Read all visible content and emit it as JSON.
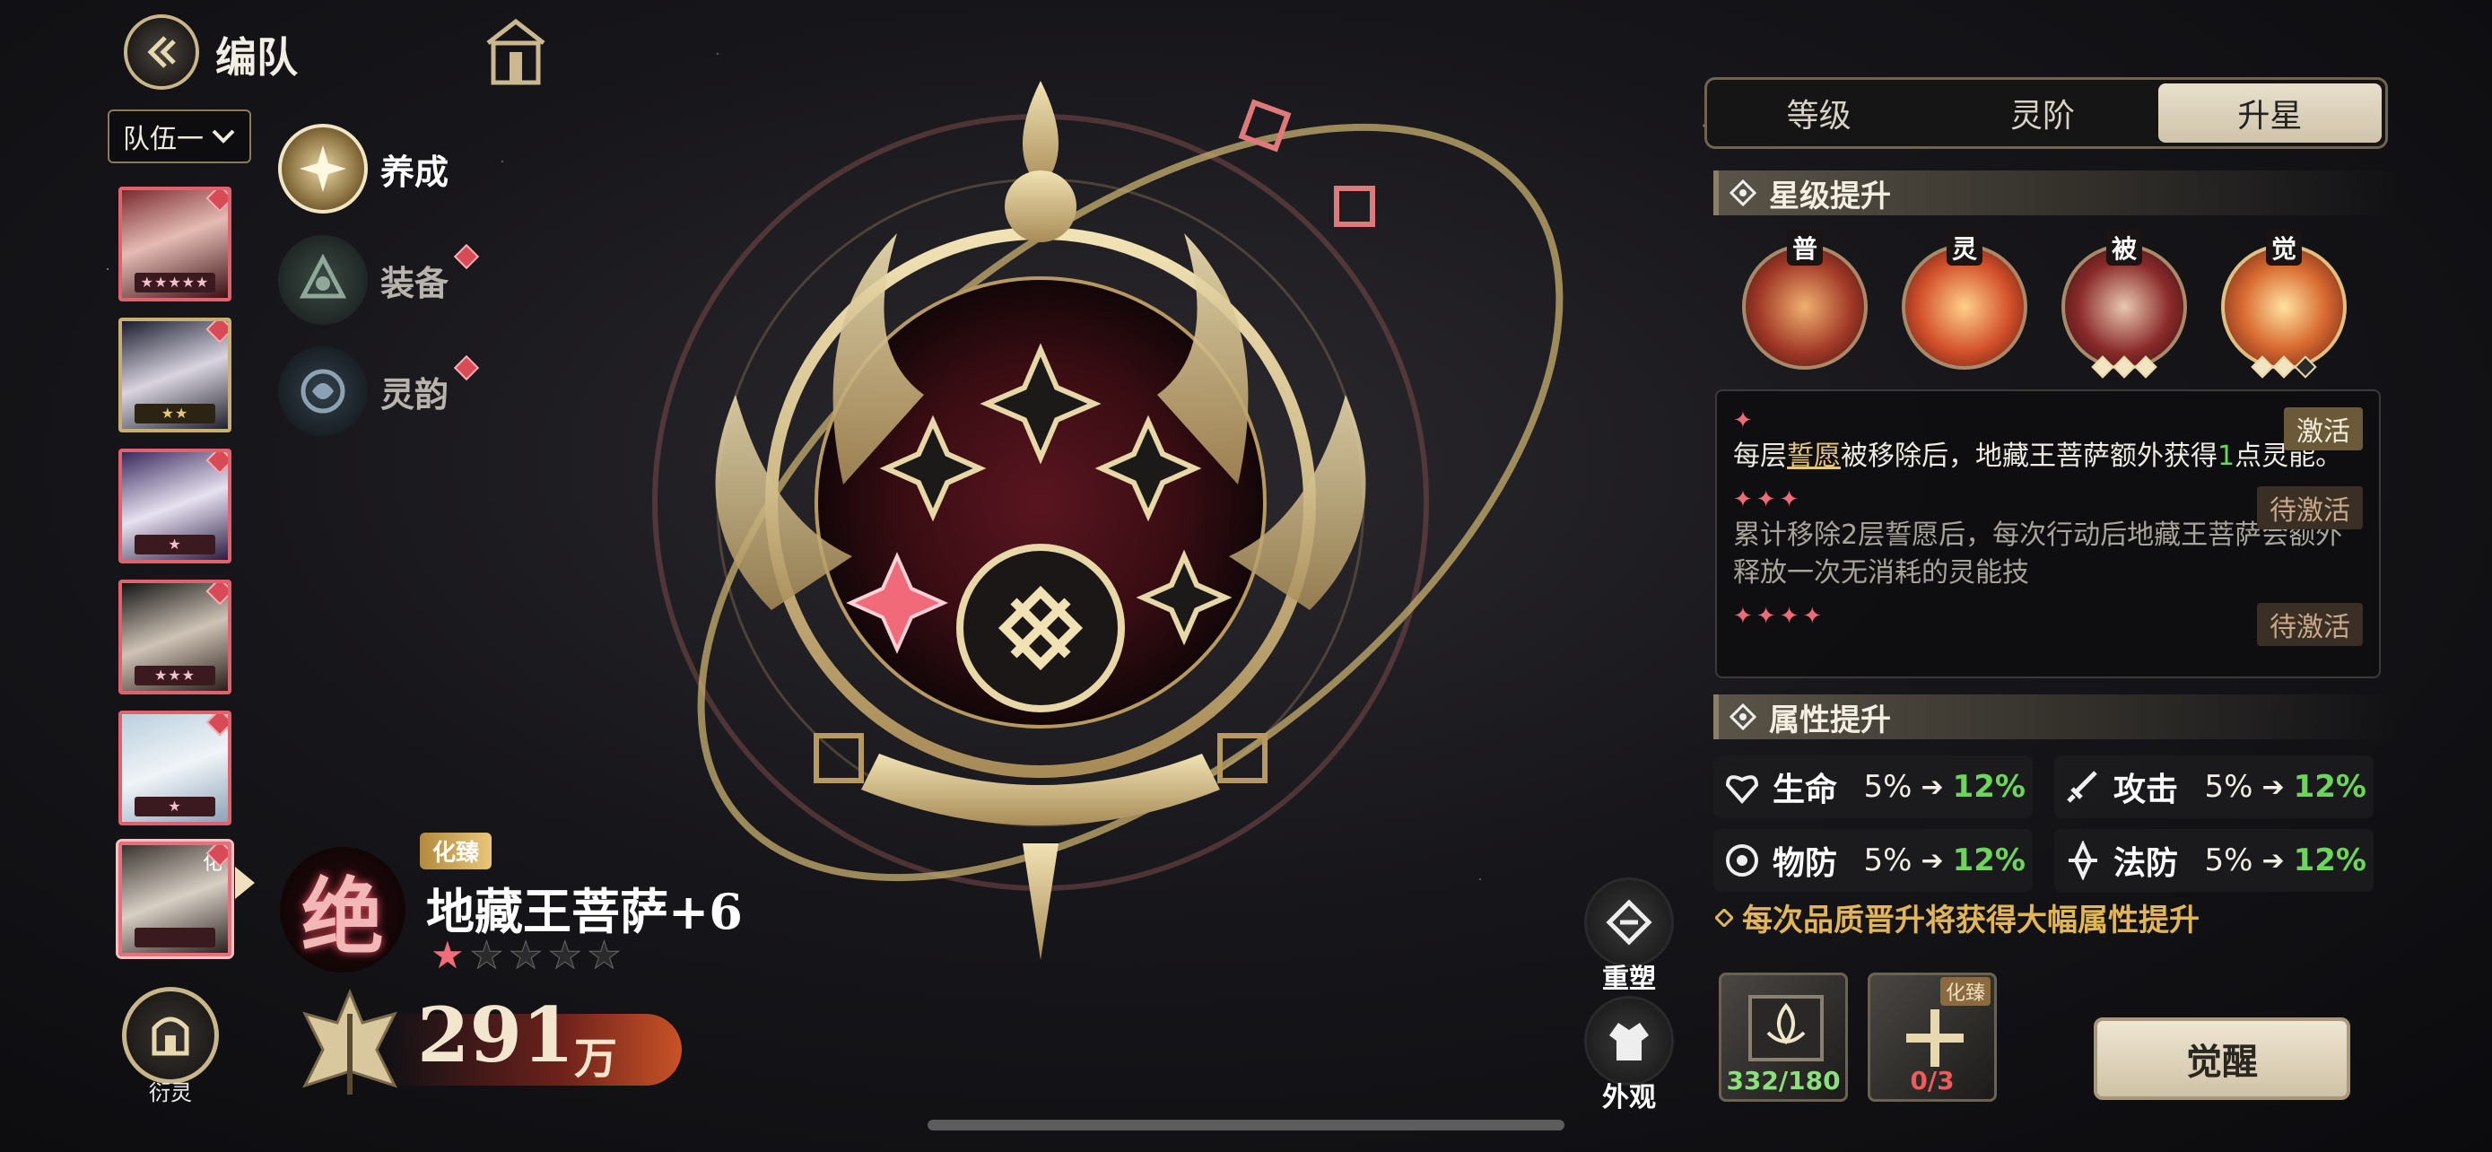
{
  "header": {
    "title": "编队"
  },
  "team_select": {
    "label": "队伍一"
  },
  "roster": [
    {
      "stars": "★★★★★"
    },
    {
      "stars": "★★"
    },
    {
      "stars": "★"
    },
    {
      "stars": "★★★"
    },
    {
      "stars": "★"
    },
    {
      "stars": "",
      "tag": "化"
    }
  ],
  "side_menu": [
    {
      "label": "养成"
    },
    {
      "label": "装备"
    },
    {
      "label": "灵韵"
    }
  ],
  "hero": {
    "grade": "绝",
    "tag": "化臻",
    "name": "地藏王菩萨+6",
    "stars_on": "★",
    "stars_off": "★★★★"
  },
  "power": {
    "value": "291",
    "unit": "万"
  },
  "bottom_left": {
    "yanling_label": "衍灵"
  },
  "actions": {
    "reshape": "重塑",
    "appearance": "外观"
  },
  "tabs": [
    {
      "label": "等级",
      "active": false
    },
    {
      "label": "灵阶",
      "active": false
    },
    {
      "label": "升星",
      "active": true
    }
  ],
  "star_section": {
    "title": "星级提升",
    "skills": [
      {
        "label": "普"
      },
      {
        "label": "灵"
      },
      {
        "label": "被"
      },
      {
        "label": "觉"
      }
    ],
    "descriptions": [
      {
        "stars": "✦",
        "status": "激活",
        "text_pre": "每层",
        "text_hl": "誓愿",
        "text_mid": "被移除后，地藏王菩萨额外获得",
        "text_num": "1",
        "text_post": "点灵能。"
      },
      {
        "stars": "✦✦✦",
        "status": "待激活",
        "text": "累计移除2层誓愿后，每次行动后地藏王菩萨会额外释放一次无消耗的灵能技"
      },
      {
        "stars": "✦✦✦✦",
        "status": "待激活"
      }
    ]
  },
  "attr_section": {
    "title": "属性提升",
    "attrs": [
      {
        "name": "生命",
        "from": "5%",
        "to": "12%"
      },
      {
        "name": "攻击",
        "from": "5%",
        "to": "12%"
      },
      {
        "name": "物防",
        "from": "5%",
        "to": "12%"
      },
      {
        "name": "法防",
        "from": "5%",
        "to": "12%"
      }
    ],
    "arrow": "➔",
    "note": "每次品质晋升将获得大幅属性提升"
  },
  "materials": [
    {
      "count": "332/180"
    },
    {
      "count": "0/3",
      "tag": "化臻"
    }
  ],
  "awaken_button": "觉醒",
  "colors": {
    "accent_gold": "#c8b58a",
    "badge_red": "#d84a55",
    "increase_green": "#6bd65a"
  }
}
